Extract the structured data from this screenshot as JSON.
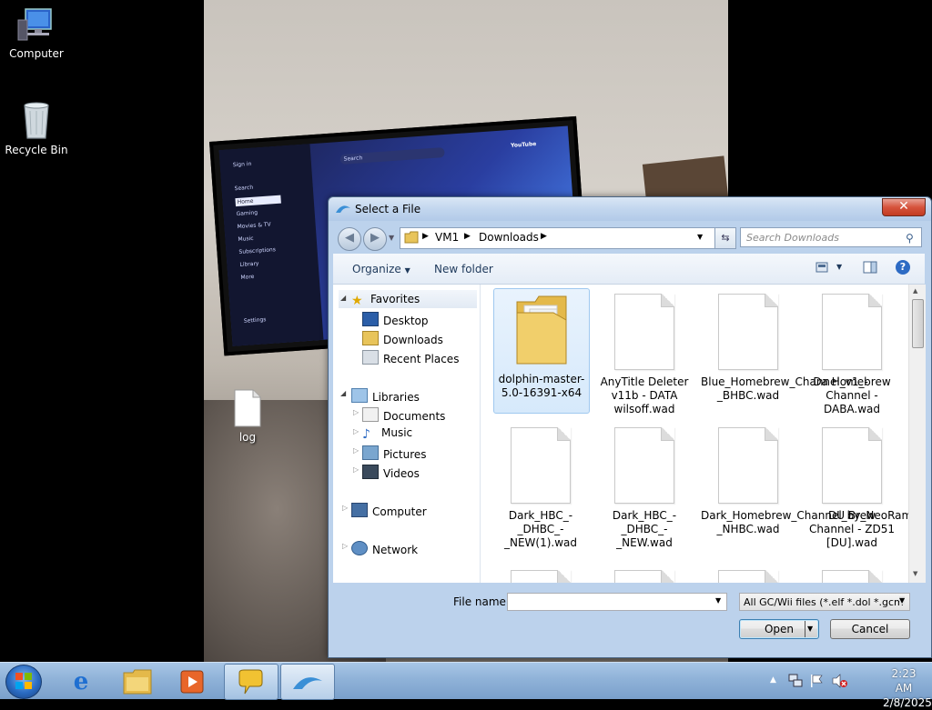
{
  "desktop": {
    "icons": [
      {
        "label": "Computer",
        "icon": "computer-icon"
      },
      {
        "label": "Recycle Bin",
        "icon": "recycle-bin-icon"
      },
      {
        "label": "log",
        "icon": "text-file-icon"
      }
    ]
  },
  "wallpaper": {
    "tv_sidebar": [
      "Sign in",
      "Search",
      "Home",
      "Gaming",
      "Movies & TV",
      "Music",
      "Subscriptions",
      "Library",
      "More",
      "Settings"
    ],
    "tv_search": "Search",
    "tv_logo": "YouTube"
  },
  "dialog": {
    "title": "Select a File",
    "close_label": "✕",
    "breadcrumb": [
      "VM1",
      "Downloads"
    ],
    "search_placeholder": "Search Downloads",
    "toolbar": {
      "organize": "Organize",
      "new_folder": "New folder"
    },
    "nav": {
      "favorites": "Favorites",
      "favorites_items": [
        "Desktop",
        "Downloads",
        "Recent Places"
      ],
      "libraries": "Libraries",
      "libraries_items": [
        "Documents",
        "Music",
        "Pictures",
        "Videos"
      ],
      "computer": "Computer",
      "network": "Network"
    },
    "files": [
      {
        "name": "dolphin-master-5.0-16391-x64",
        "type": "folder",
        "selected": true
      },
      {
        "name": "AnyTitle Deleter v11b - DATA wilsoff.wad",
        "type": "file"
      },
      {
        "name": "Blue_Homebrew_Channel_v1_-_BHBC.wad",
        "type": "file"
      },
      {
        "name": "Da Homebrew Channel - DABA.wad",
        "type": "file"
      },
      {
        "name": "Dark_HBC_-_DHBC_-_NEW(1).wad",
        "type": "file"
      },
      {
        "name": "Dark_HBC_-_DHBC_-_NEW.wad",
        "type": "file"
      },
      {
        "name": "Dark_Homebrew_Channel_by_NeoRame-_NHBC.wad",
        "type": "file"
      },
      {
        "name": "DU Brew Channel - ZD51 [DU].wad",
        "type": "file"
      }
    ],
    "file_name_label": "File name:",
    "file_name_value": "",
    "filter_value": "All GC/Wii files (*.elf *.dol *.gcm",
    "open_label": "Open",
    "cancel_label": "Cancel"
  },
  "taskbar": {
    "time": "2:23 AM",
    "date": "2/8/2025"
  },
  "colors": {
    "taskbar": "#8fb2d8",
    "dialog_frame": "#bcd2ec",
    "close_button": "#c23b22"
  }
}
